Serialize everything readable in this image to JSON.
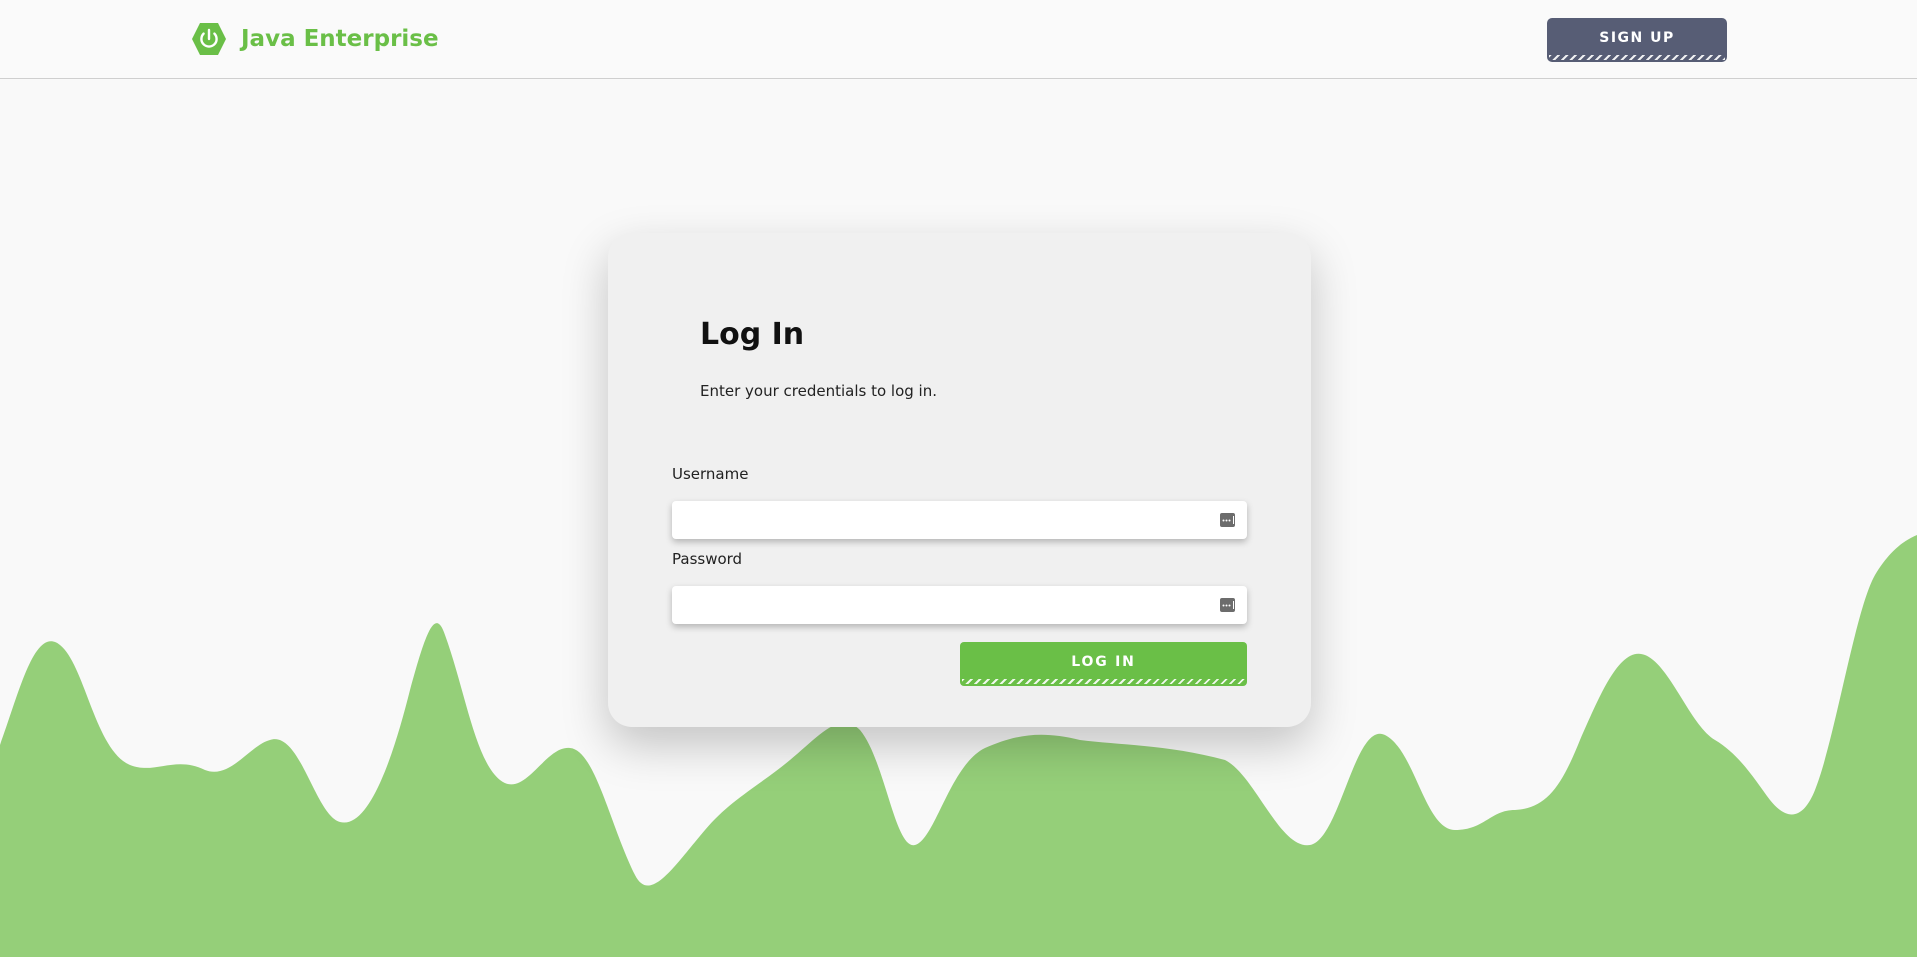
{
  "header": {
    "brand_name": "Java Enterprise",
    "brand_icon": "power-hexagon-icon",
    "signup_label": "SIGN UP"
  },
  "login_card": {
    "title": "Log In",
    "subtitle": "Enter your credentials to log in.",
    "username": {
      "label": "Username",
      "value": "",
      "icon": "password-dots-icon"
    },
    "password": {
      "label": "Password",
      "value": "",
      "icon": "password-dots-icon"
    },
    "login_label": "LOG IN"
  },
  "colors": {
    "brand_green": "#6abf47",
    "wave_green": "#95cf79",
    "signup_button": "#575d75",
    "card_background": "#f0f0f0",
    "page_background": "#f9f9f9"
  }
}
